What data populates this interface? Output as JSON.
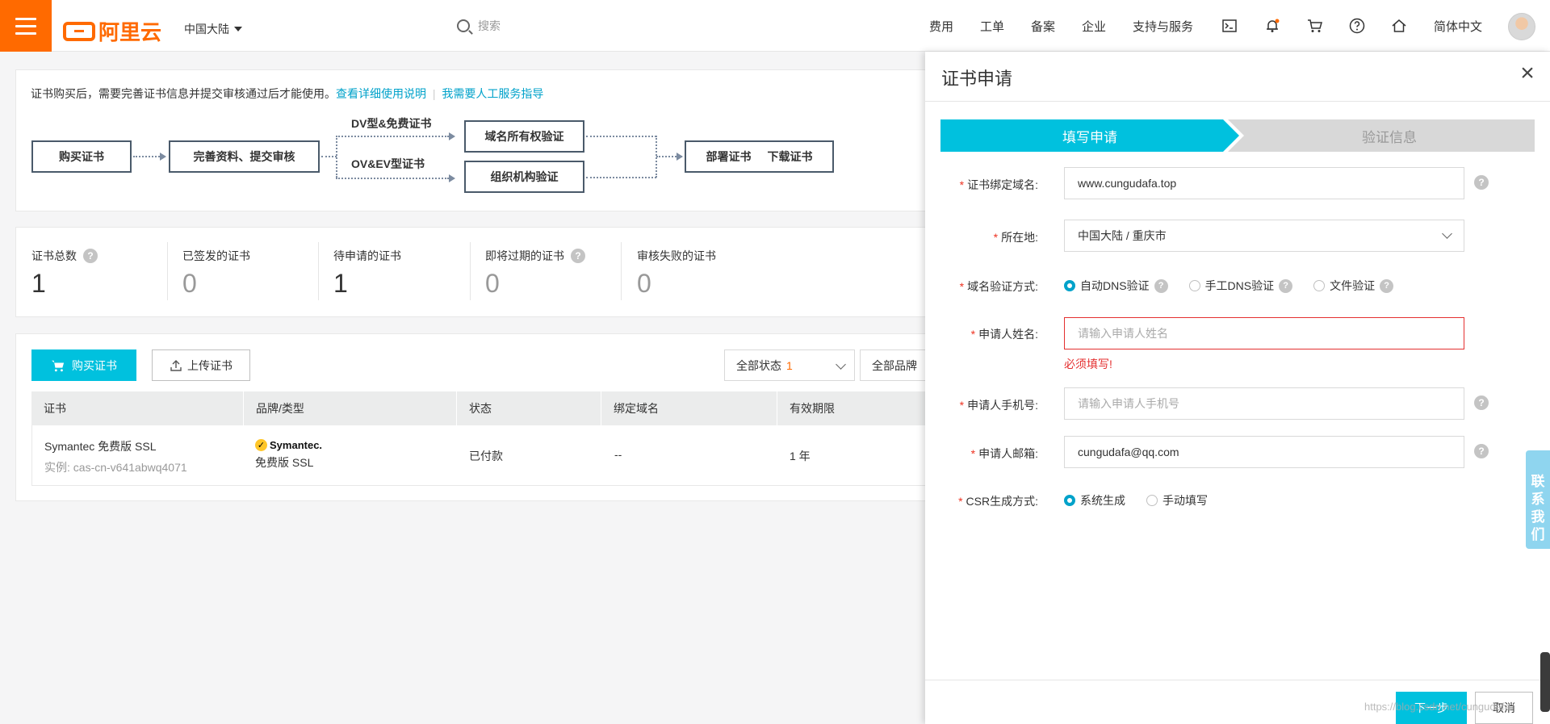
{
  "topbar": {
    "brand": "阿里云",
    "region": "中国大陆",
    "search_placeholder": "搜索",
    "nav": [
      "费用",
      "工单",
      "备案",
      "企业",
      "支持与服务"
    ],
    "language": "简体中文",
    "accent": "#ff6a00"
  },
  "intro": {
    "text": "证书购买后，需要完善证书信息并提交审核通过后才能使用。",
    "link1": "查看详细使用说明",
    "separator": "|",
    "link2": "我需要人工服务指导"
  },
  "flow": {
    "buy": "购买证书",
    "complete": "完善资料、提交审核",
    "dv_label": "DV型&免费证书",
    "ov_label": "OV&EV型证书",
    "domain_verify": "域名所有权验证",
    "org_verify": "组织机构验证",
    "deploy": "部署证书",
    "download": "下载证书"
  },
  "stats": [
    {
      "label": "证书总数",
      "value": "1",
      "help": true
    },
    {
      "label": "已签发的证书",
      "value": "0",
      "help": false
    },
    {
      "label": "待申请的证书",
      "value": "1",
      "help": false
    },
    {
      "label": "即将过期的证书",
      "value": "0",
      "help": true
    },
    {
      "label": "审核失败的证书",
      "value": "0",
      "help": false
    }
  ],
  "toolbar": {
    "buy_label": "购买证书",
    "upload_label": "上传证书",
    "status_filter": "全部状态",
    "status_count": "1",
    "brand_filter": "全部品牌"
  },
  "table": {
    "columns": [
      "证书",
      "品牌/类型",
      "状态",
      "绑定域名",
      "有效期限"
    ],
    "rows": [
      {
        "cert": "Symantec 免费版 SSL",
        "instance": "实例: cas-cn-v641abwq4071",
        "brand_logo": "Symantec.",
        "brand_type": "免费版 SSL",
        "status": "已付款",
        "domain": "--",
        "validity": "1 年"
      }
    ]
  },
  "drawer": {
    "title": "证书申请",
    "close": "×",
    "steps": [
      "填写申请",
      "验证信息"
    ],
    "fields": {
      "domain_label": "证书绑定域名:",
      "domain_value": "www.cungudafa.top",
      "location_label": "所在地:",
      "location_value": "中国大陆 / 重庆市",
      "verify_label": "域名验证方式:",
      "verify_options": [
        "自动DNS验证",
        "手工DNS验证",
        "文件验证"
      ],
      "name_label": "申请人姓名:",
      "name_placeholder": "请输入申请人姓名",
      "name_error": "必须填写!",
      "phone_label": "申请人手机号:",
      "phone_placeholder": "请输入申请人手机号",
      "email_label": "申请人邮箱:",
      "email_value": "cungudafa@qq.com",
      "csr_label": "CSR生成方式:",
      "csr_options": [
        "系统生成",
        "手动填写"
      ]
    },
    "next_label": "下一步",
    "cancel_label": "取消"
  },
  "side": {
    "contact": [
      "联",
      "系",
      "我",
      "们"
    ],
    "watermark": "https://blog.csdn.net/cungudafa"
  }
}
